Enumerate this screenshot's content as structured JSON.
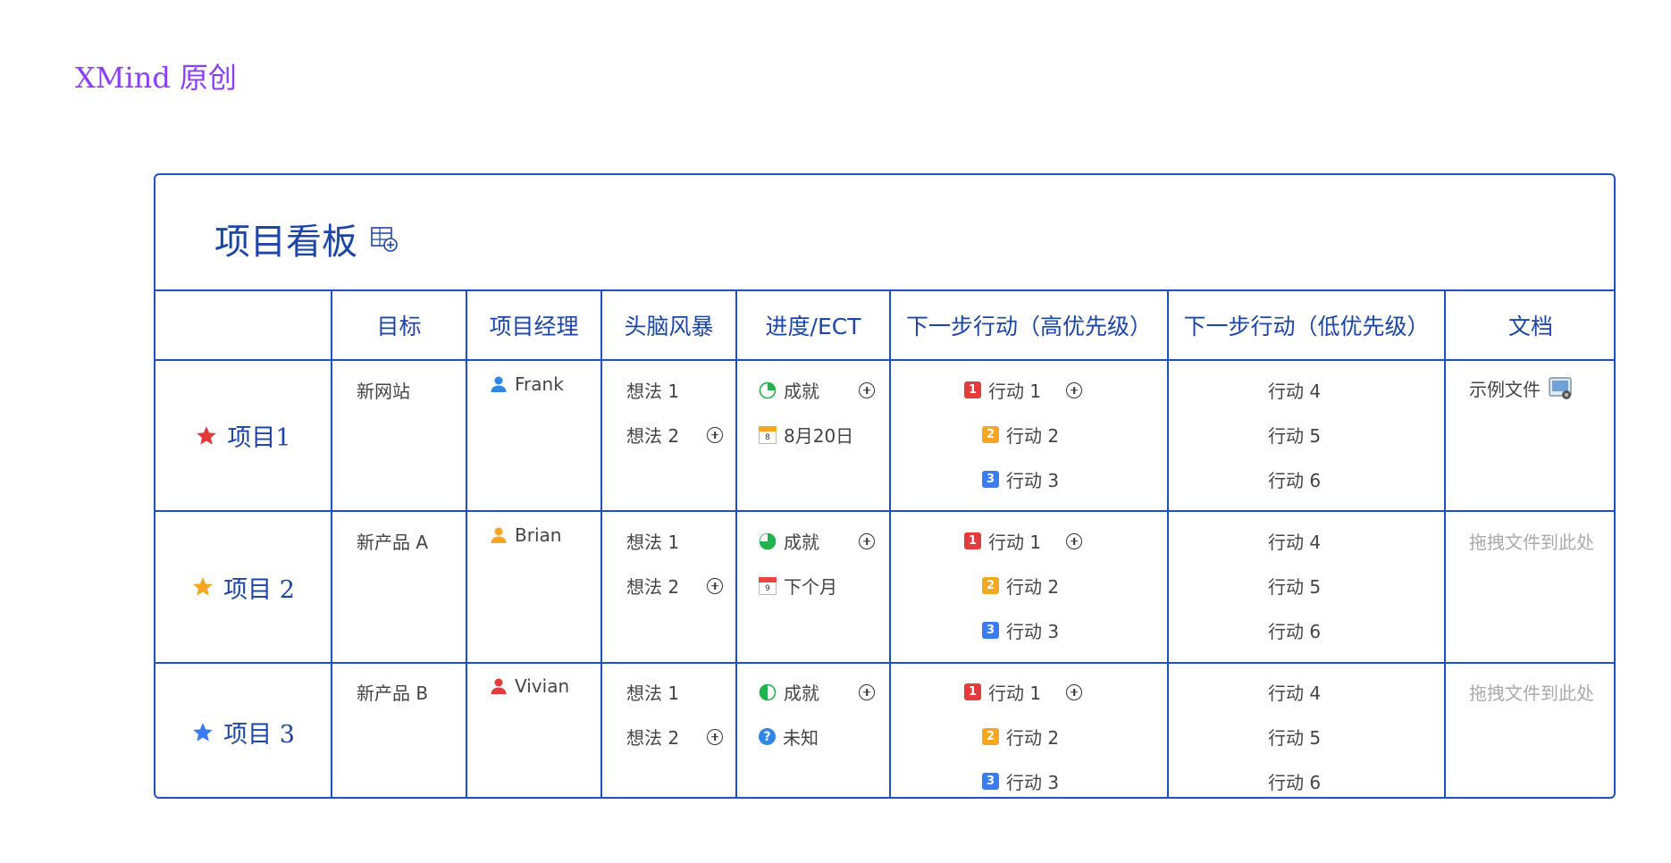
{
  "brand": "XMind 原创",
  "board": {
    "title": "项目看板",
    "headers": [
      "目标",
      "项目经理",
      "头脑风暴",
      "进度/ECT",
      "下一步行动（高优先级）",
      "下一步行动（低优先级）",
      "文档"
    ]
  },
  "colors": {
    "border": "#1e4fc4",
    "heading": "#1c45a8",
    "red": "#e33b3b",
    "orange": "#f5a623",
    "blue": "#3b7cf0"
  },
  "rows": [
    {
      "label": "项目1",
      "star_color": "#e33b3b",
      "icon": "star-icon",
      "goal": "新网站",
      "manager": "Frank",
      "manager_color": "#2f86e6",
      "ideas": [
        "想法 1",
        "想法 2"
      ],
      "progress": "成就",
      "progress_fraction": 0.25,
      "ect": "8月20日",
      "ect_day": "8",
      "high": [
        "行动 1",
        "行动 2",
        "行动 3"
      ],
      "low": [
        "行动 4",
        "行动 5",
        "行动 6"
      ],
      "doc": "示例文件"
    },
    {
      "label": "项目 2",
      "star_color": "#f5a623",
      "icon": "star-icon",
      "goal": "新产品 A",
      "manager": "Brian",
      "manager_color": "#f5a623",
      "ideas": [
        "想法 1",
        "想法 2"
      ],
      "progress": "成就",
      "progress_fraction": 0.75,
      "ect": "下个月",
      "ect_day": "9",
      "high": [
        "行动 1",
        "行动 2",
        "行动 3"
      ],
      "low": [
        "行动 4",
        "行动 5",
        "行动 6"
      ],
      "doc": "拖拽文件到此处"
    },
    {
      "label": "项目 3",
      "star_color": "#3b7cf0",
      "icon": "star-icon",
      "goal": "新产品 B",
      "manager": "Vivian",
      "manager_color": "#e33b3b",
      "ideas": [
        "想法 1",
        "想法 2"
      ],
      "progress": "成就",
      "progress_fraction": 0.5,
      "ect": "未知",
      "high": [
        "行动 1",
        "行动 2",
        "行动 3"
      ],
      "low": [
        "行动 4",
        "行动 5",
        "行动 6"
      ],
      "doc": "拖拽文件到此处"
    }
  ],
  "priority_badges": [
    {
      "text": "1",
      "color": "#e33b3b"
    },
    {
      "text": "2",
      "color": "#f5a623"
    },
    {
      "text": "3",
      "color": "#3b7cf0"
    }
  ]
}
